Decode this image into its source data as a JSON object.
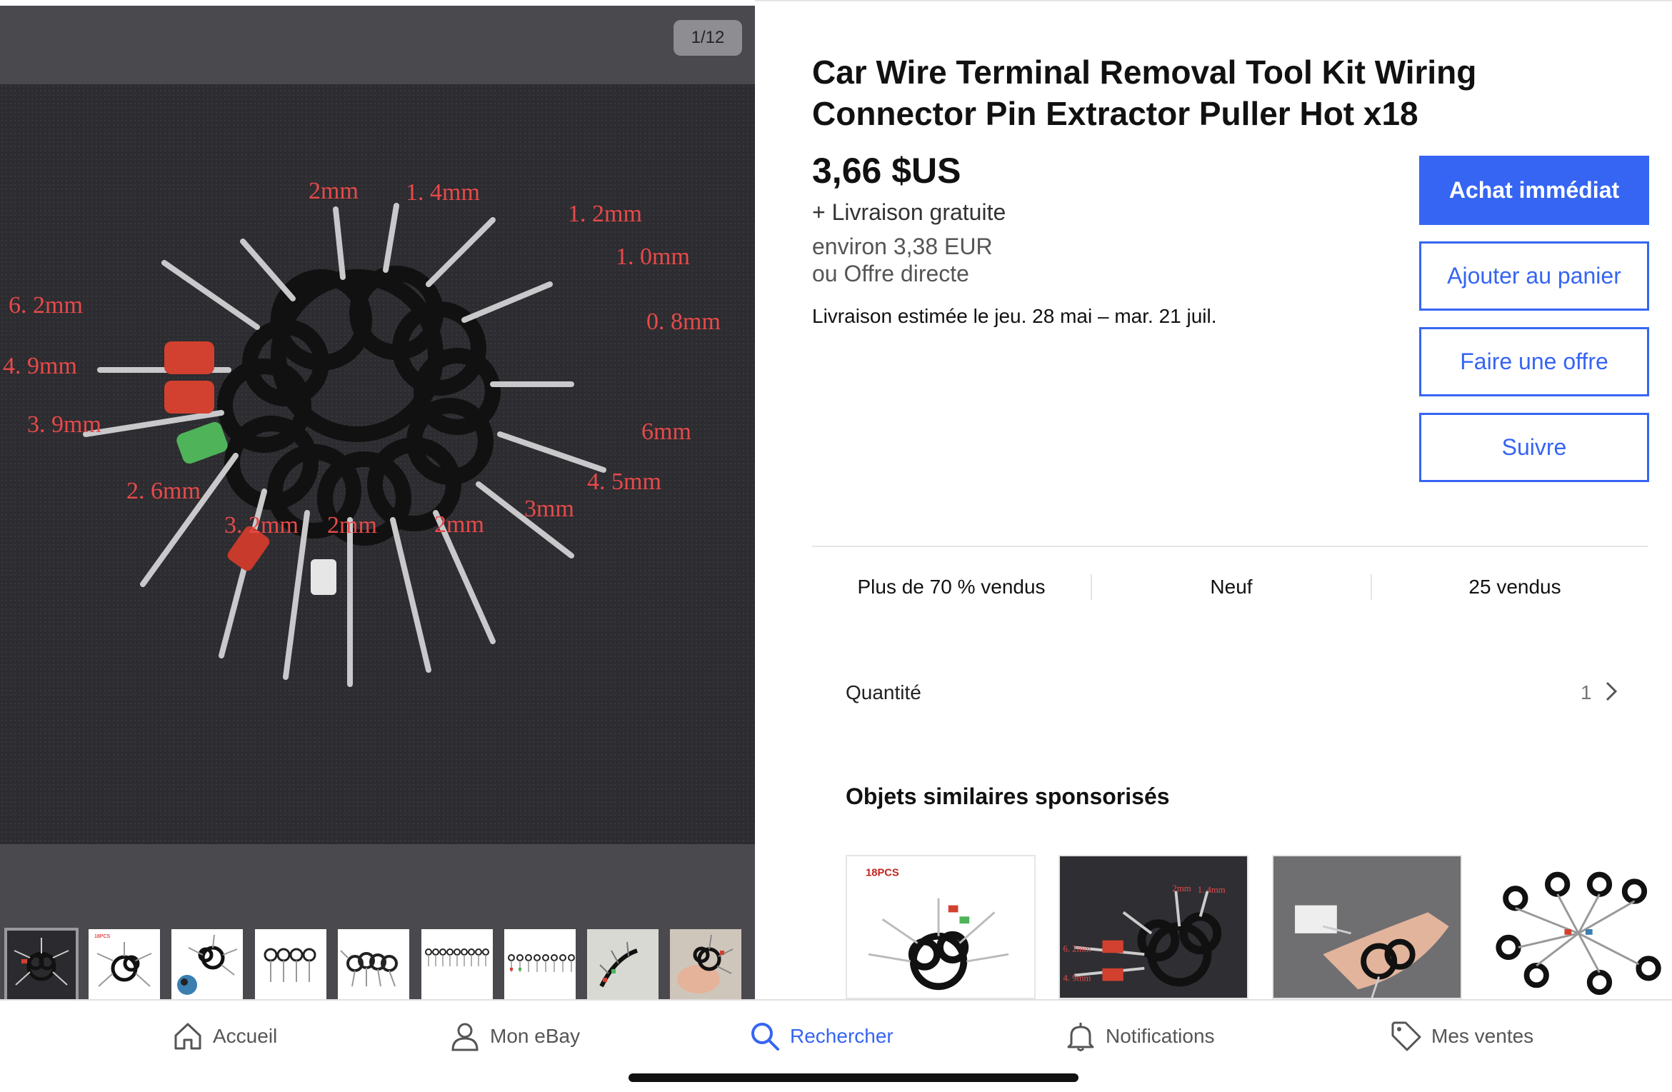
{
  "gallery": {
    "counter": "1/12",
    "photo_labels": [
      "2mm",
      "1. 4mm",
      "1. 2mm",
      "1. 0mm",
      "0. 8mm",
      "6. 2mm",
      "4. 9mm",
      "3. 9mm",
      "6mm",
      "4. 5mm",
      "3mm",
      "2. 6mm",
      "3. 2mm",
      "2mm",
      "2mm"
    ],
    "thumb_text": "18PCS"
  },
  "product": {
    "title": "Car Wire Terminal Removal Tool Kit Wiring Connector Pin Extractor Puller Hot x18",
    "price": "3,66 $US",
    "shipping": "+ Livraison gratuite",
    "converted": "environ 3,38 EUR",
    "offer": "ou Offre directe",
    "delivery_prefix": "Livraison estimée le ",
    "delivery_dates": "jeu. 28 mai – mar. 21 juil."
  },
  "actions": {
    "buy_now": "Achat immédiat",
    "add_to_cart": "Ajouter au panier",
    "make_offer": "Faire une offre",
    "follow": "Suivre"
  },
  "stats": {
    "sold_percent": "Plus de 70 % vendus",
    "condition": "Neuf",
    "sold_count": "25 vendus"
  },
  "quantity": {
    "label": "Quantité",
    "value": "1"
  },
  "similar": {
    "title": "Objets similaires sponsorisés",
    "card1_badge": "18PCS",
    "card2_labels": [
      "2mm",
      "1. 4mm",
      "6. 2mm",
      "4. 9mm"
    ]
  },
  "nav": {
    "home": "Accueil",
    "my_ebay": "Mon eBay",
    "search": "Rechercher",
    "notifications": "Notifications",
    "selling": "Mes ventes"
  },
  "colors": {
    "accent": "#3665f3",
    "gallery_bg": "#4a494e",
    "label_red": "#e84a4a"
  }
}
